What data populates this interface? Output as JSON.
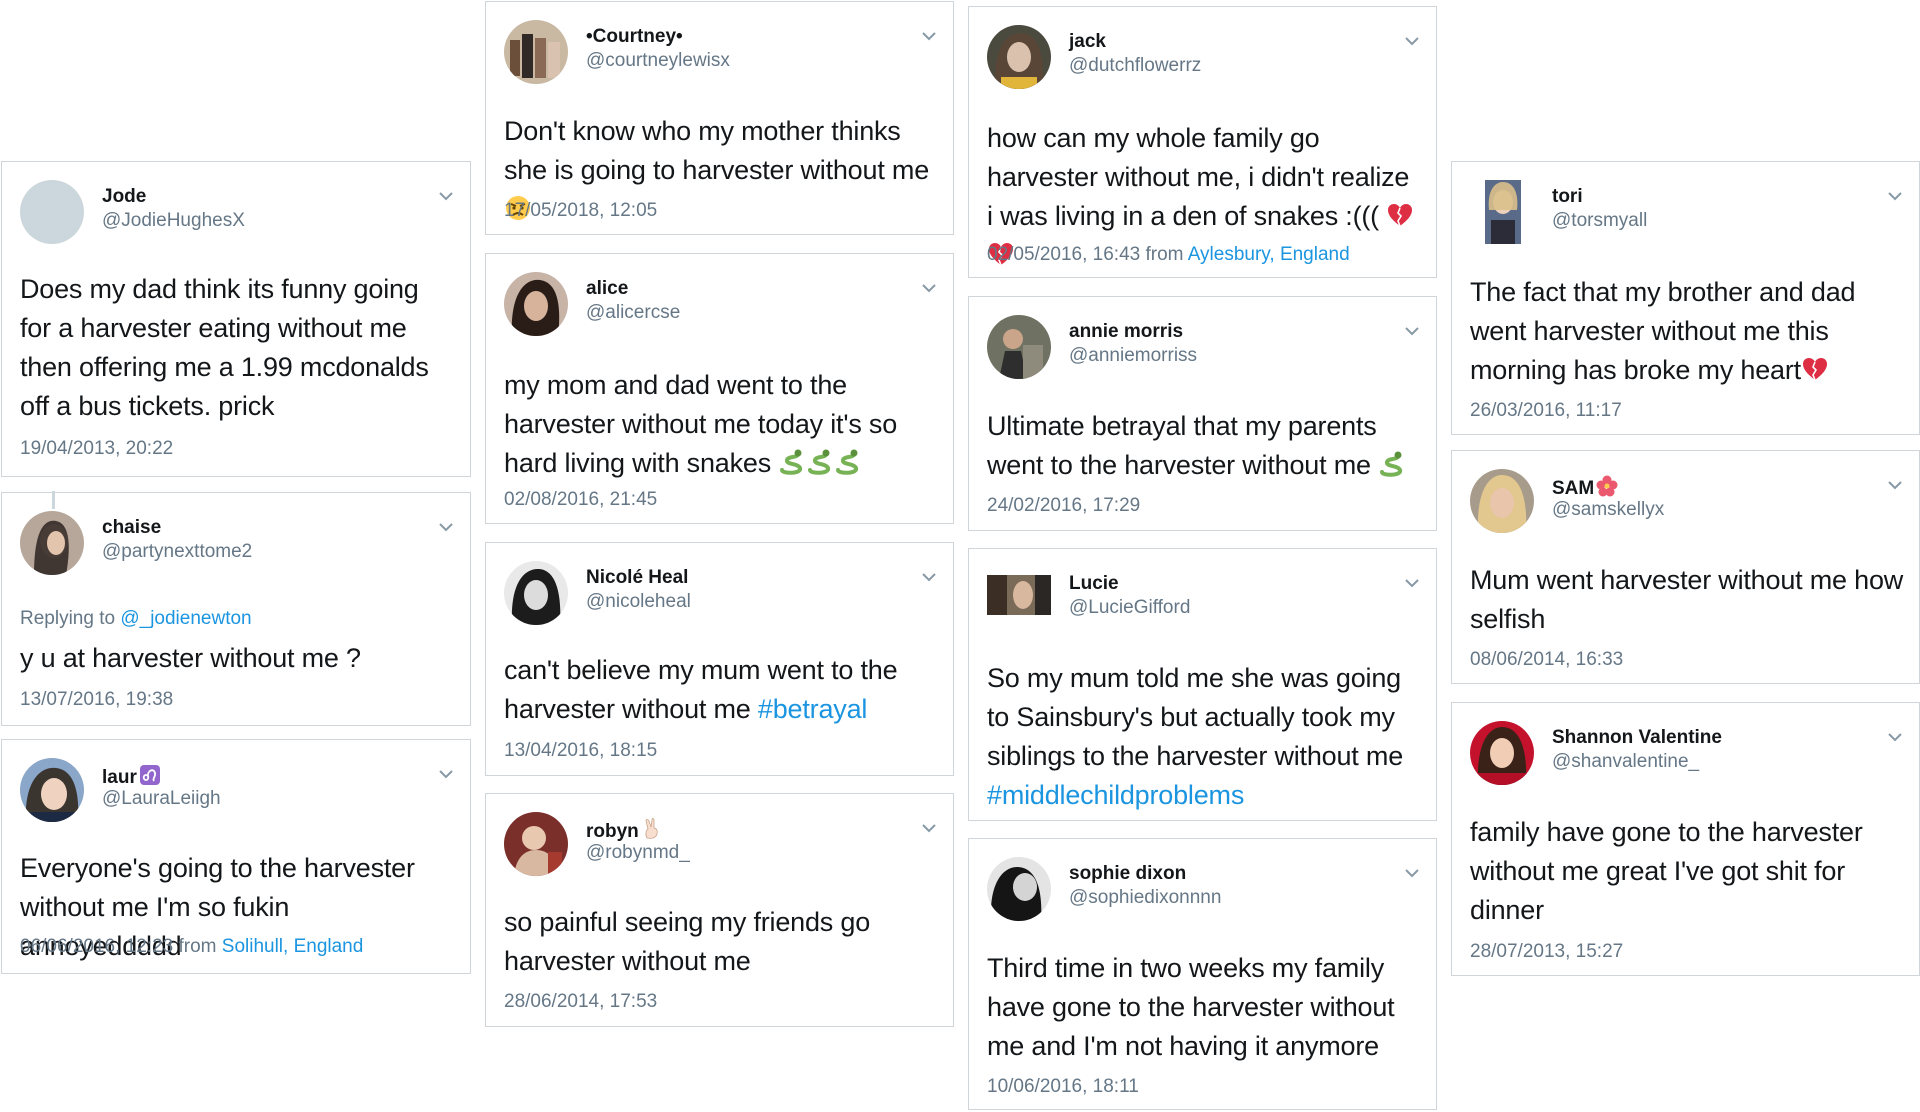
{
  "colors": {
    "link": "#1b95e0",
    "muted": "#657786",
    "border": "#d0d5da",
    "text": "#14171a"
  },
  "tweets": [
    {
      "name": "Jode",
      "handle": "@JodieHughesX",
      "text": "Does my dad think its funny going for a harvester eating without me then offering me a 1.99 mcdonalds off a bus tickets. prick",
      "date": "19/04/2013, 20:22"
    },
    {
      "name": "chaise",
      "handle": "@partynexttome2",
      "reply_prefix": "Replying to",
      "reply_to": "@_jodienewton",
      "text": "y u at harvester without me ?",
      "date": "13/07/2016, 19:38"
    },
    {
      "name": "laur",
      "handle": "@LauraLeiigh",
      "text": "Everyone's going to the harvester without me I'm so fukin annoyeddddd",
      "date": "06/06/2016, 12:23",
      "from": "from",
      "location": "Solihull, England"
    },
    {
      "name": "•Courtney•",
      "handle": "@courtneylewisx",
      "text": "Don't know who my mother thinks she is going to harvester without me",
      "date": "17/05/2018, 12:05"
    },
    {
      "name": "alice",
      "handle": "@alicercse",
      "text": "my mom and dad went to the harvester without me today it's so hard living with snakes",
      "date": "02/08/2016, 21:45"
    },
    {
      "name": "Nicolé Heal",
      "handle": "@nicoleheal",
      "text": "can't believe my mum went to the harvester without me",
      "hashtag": "#betrayal",
      "date": "13/04/2016, 18:15"
    },
    {
      "name": "robyn",
      "handle": "@robynmd_",
      "text": "so painful seeing my friends go harvester without me",
      "date": "28/06/2014, 17:53"
    },
    {
      "name": "jack",
      "handle": "@dutchflowerrz",
      "text": "how can my whole family go harvester without me, i didn't realize i was living in a den of snakes :(((",
      "date": "02/05/2016, 16:43",
      "from": "from",
      "location": "Aylesbury, England"
    },
    {
      "name": "annie morris",
      "handle": "@anniemorriss",
      "text": "Ultimate betrayal that my parents went to the harvester without me",
      "date": "24/02/2016, 17:29"
    },
    {
      "name": "Lucie",
      "handle": "@LucieGifford",
      "text": "So my mum told me she was going to Sainsbury's but actually took my siblings to the harvester without me",
      "hashtag": "#middlechildproblems",
      "date": ""
    },
    {
      "name": "sophie dixon",
      "handle": "@sophiedixonnnn",
      "text": "Third time in two weeks my family have gone to the harvester without me and I'm not having it anymore",
      "date": "10/06/2016, 18:11"
    },
    {
      "name": "tori",
      "handle": "@torsmyall",
      "text": "The fact that my brother and dad went harvester without me this morning has broke my heart",
      "date": "26/03/2016, 11:17"
    },
    {
      "name": "SAM",
      "handle": "@samskellyx",
      "text": "Mum went harvester without me how selfish",
      "date": "08/06/2014, 16:33"
    },
    {
      "name": "Shannon Valentine",
      "handle": "@shanvalentine_",
      "text": "family have gone to the harvester without me  great I've got shit for dinner",
      "date": "28/07/2013, 15:27"
    }
  ]
}
